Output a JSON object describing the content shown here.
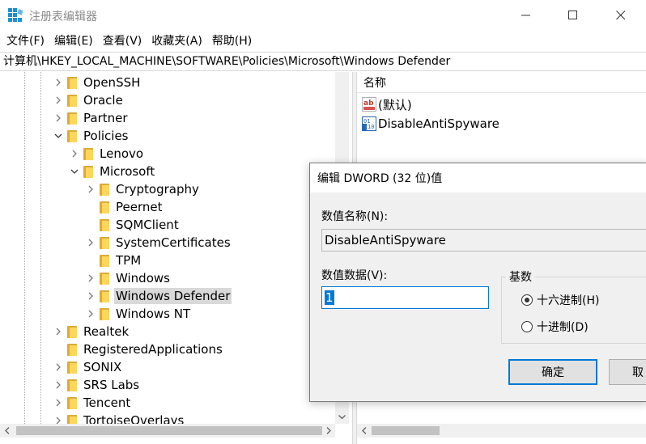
{
  "window": {
    "title": "注册表编辑器",
    "accent": "#0078d7"
  },
  "menu": [
    "文件(F)",
    "编辑(E)",
    "查看(V)",
    "收藏夹(A)",
    "帮助(H)"
  ],
  "address": "计算机\\HKEY_LOCAL_MACHINE\\SOFTWARE\\Policies\\Microsoft\\Windows Defender",
  "tree": {
    "items": [
      {
        "label": "OpenSSH",
        "level": 1,
        "state": "collapsed"
      },
      {
        "label": "Oracle",
        "level": 1,
        "state": "collapsed"
      },
      {
        "label": "Partner",
        "level": 1,
        "state": "collapsed"
      },
      {
        "label": "Policies",
        "level": 1,
        "state": "expanded"
      },
      {
        "label": "Lenovo",
        "level": 2,
        "state": "collapsed"
      },
      {
        "label": "Microsoft",
        "level": 2,
        "state": "expanded"
      },
      {
        "label": "Cryptography",
        "level": 3,
        "state": "collapsed"
      },
      {
        "label": "Peernet",
        "level": 3,
        "state": "none"
      },
      {
        "label": "SQMClient",
        "level": 3,
        "state": "none"
      },
      {
        "label": "SystemCertificates",
        "level": 3,
        "state": "collapsed"
      },
      {
        "label": "TPM",
        "level": 3,
        "state": "none"
      },
      {
        "label": "Windows",
        "level": 3,
        "state": "collapsed"
      },
      {
        "label": "Windows Defender",
        "level": 3,
        "state": "collapsed",
        "selected": true
      },
      {
        "label": "Windows NT",
        "level": 3,
        "state": "collapsed"
      },
      {
        "label": "Realtek",
        "level": 1,
        "state": "collapsed"
      },
      {
        "label": "RegisteredApplications",
        "level": 1,
        "state": "none"
      },
      {
        "label": "SONIX",
        "level": 1,
        "state": "collapsed"
      },
      {
        "label": "SRS Labs",
        "level": 1,
        "state": "collapsed"
      },
      {
        "label": "Tencent",
        "level": 1,
        "state": "collapsed"
      },
      {
        "label": "TortoiseOverlays",
        "level": 1,
        "state": "collapsed"
      }
    ]
  },
  "list": {
    "column_name": "名称",
    "values": [
      {
        "name": "(默认)",
        "icon": "string-value-icon"
      },
      {
        "name": "DisableAntiSpyware",
        "icon": "dword-value-icon"
      }
    ]
  },
  "dialog": {
    "title": "编辑 DWORD (32 位)值",
    "value_name_label": "数值名称(N):",
    "value_name": "DisableAntiSpyware",
    "value_data_label": "数值数据(V):",
    "value_data": "1",
    "base_label": "基数",
    "radio_hex": "十六进制(H)",
    "radio_dec": "十进制(D)",
    "ok_label": "确定",
    "cancel_label": "取"
  }
}
